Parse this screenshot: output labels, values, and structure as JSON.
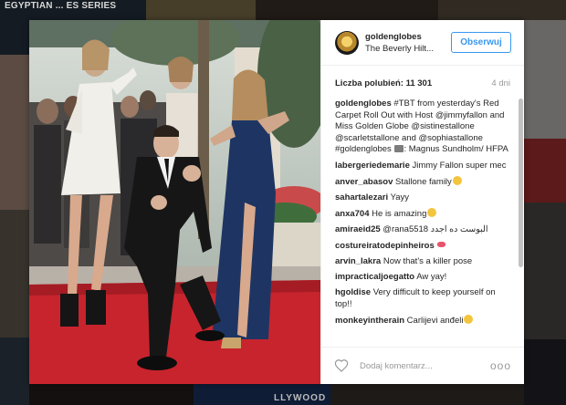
{
  "background": {
    "caption_top": "EGYPTIAN ... ES SERIES",
    "caption_bottom": "LLYWOOD"
  },
  "post": {
    "username": "goldenglobes",
    "location": "The Beverly Hilt...",
    "follow_label": "Obserwuj",
    "likes_label": "Liczba polubień: 11 301",
    "age": "4 dni",
    "comments": [
      {
        "user": "goldenglobes",
        "text": "#TBT from yesterday's Red Carpet Roll Out with Host @jimmyfallon and Miss Golden Globe @sistinestallone @scarletstallone and @sophiastallone #goldenglobes",
        "text2": ": Magnus Sundholm/ HFPA"
      },
      {
        "user": "labergeriedemarie",
        "text": "Jimmy Fallon super mec"
      },
      {
        "user": "anver_abasov",
        "text": "Stallone family"
      },
      {
        "user": "sahartalezari",
        "text": "Yayy"
      },
      {
        "user": "anxa704",
        "text": "He is amazing"
      },
      {
        "user": "amiraeid25",
        "text": "@rana5518 البوست ده اجدد"
      },
      {
        "user": "costureiratodepinheiros",
        "text": ""
      },
      {
        "user": "arvin_lakra",
        "text": "Now that's a killer pose"
      },
      {
        "user": "impracticaljoegatto",
        "text": "Aw yay!"
      },
      {
        "user": "hgoldise",
        "text": "Very difficult to keep yourself on top!!"
      },
      {
        "user": "monkeyintherain",
        "text": "Carlijevi anđeli"
      }
    ],
    "comment_placeholder": "Dodaj komentarz...",
    "more_label": "ooo"
  },
  "icons": {
    "heart": "heart-icon",
    "more": "more-options-icon"
  },
  "colors": {
    "accent": "#3897f0",
    "carpet": "#c8242d"
  }
}
